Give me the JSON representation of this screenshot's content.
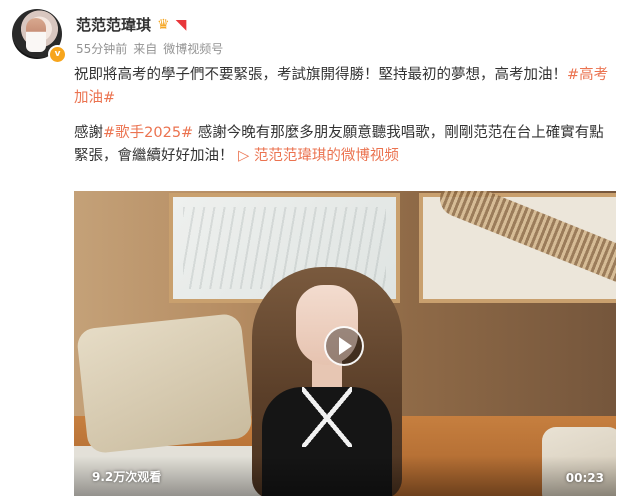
{
  "author": {
    "name": "范范范瑋琪",
    "time": "55分钟前",
    "source_prefix": "来自",
    "source": "微博视频号",
    "badge_icons": [
      "crown-icon",
      "weibo-bird-icon"
    ],
    "verified_icon": "verified-v-icon"
  },
  "post": {
    "line1_text": "祝即將高考的學子們不要緊張，考試旗開得勝！堅持最初的夢想，高考加油！",
    "line1_tag": "#高考加油#",
    "line2_prefix": "感謝",
    "line2_tag": "#歌手2025#",
    "line2_text": " 感謝今晚有那麼多朋友願意聽我唱歌，剛剛范范在台上確實有點緊張，會繼續好好加油！",
    "video_link_icon": "video-link-icon",
    "video_link": "范范范瑋琪的微博视频"
  },
  "video": {
    "views": "9.2万次观看",
    "duration": "00:23",
    "play_icon": "play-icon"
  },
  "colors": {
    "accent": "#eb7350",
    "meta_gray": "#939393",
    "text": "#333333"
  }
}
